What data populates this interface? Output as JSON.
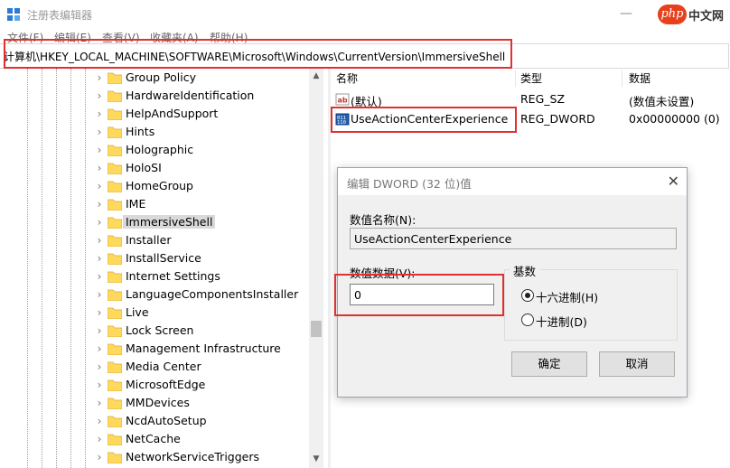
{
  "window": {
    "title": "注册表编辑器",
    "minimize_glyph": "—",
    "watermark_logo": "php",
    "watermark_text": "中文网"
  },
  "menu": [
    "文件(F)",
    "编辑(E)",
    "查看(V)",
    "收藏夹(A)",
    "帮助(H)"
  ],
  "address": {
    "path": "计算机\\HKEY_LOCAL_MACHINE\\SOFTWARE\\Microsoft\\Windows\\CurrentVersion\\ImmersiveShell"
  },
  "tree": {
    "items": [
      {
        "label": "Group Policy"
      },
      {
        "label": "HardwareIdentification"
      },
      {
        "label": "HelpAndSupport"
      },
      {
        "label": "Hints"
      },
      {
        "label": "Holographic"
      },
      {
        "label": "HoloSI"
      },
      {
        "label": "HomeGroup"
      },
      {
        "label": "IME"
      },
      {
        "label": "ImmersiveShell"
      },
      {
        "label": "Installer"
      },
      {
        "label": "InstallService"
      },
      {
        "label": "Internet Settings"
      },
      {
        "label": "LanguageComponentsInstaller"
      },
      {
        "label": "Live"
      },
      {
        "label": "Lock Screen"
      },
      {
        "label": "Management Infrastructure"
      },
      {
        "label": "Media Center"
      },
      {
        "label": "MicrosoftEdge"
      },
      {
        "label": "MMDevices"
      },
      {
        "label": "NcdAutoSetup"
      },
      {
        "label": "NetCache"
      },
      {
        "label": "NetworkServiceTriggers"
      }
    ],
    "selected_label": "ImmersiveShell",
    "scroll_up_glyph": "▲",
    "scroll_down_glyph": "▼"
  },
  "list": {
    "columns": [
      "名称",
      "类型",
      "数据"
    ],
    "rows": [
      {
        "name": "(默认)",
        "type": "REG_SZ",
        "data": "(数值未设置)",
        "icon": "string-value-icon"
      },
      {
        "name": "UseActionCenterExperience",
        "type": "REG_DWORD",
        "data": "0x00000000 (0)",
        "icon": "binary-value-icon"
      }
    ]
  },
  "dialog": {
    "title": "编辑 DWORD (32 位)值",
    "close_glyph": "✕",
    "name_label": "数值名称(N):",
    "name_value": "UseActionCenterExperience",
    "data_label": "数值数据(V):",
    "data_value": "0",
    "base_label": "基数",
    "hex_label": "十六进制(H)",
    "dec_label": "十进制(D)",
    "selected_base": "hex",
    "ok_label": "确定",
    "cancel_label": "取消"
  },
  "colors": {
    "highlight_box": "#e03030",
    "folder": "#ffd95c",
    "selected_row": "#d9d9d9"
  }
}
